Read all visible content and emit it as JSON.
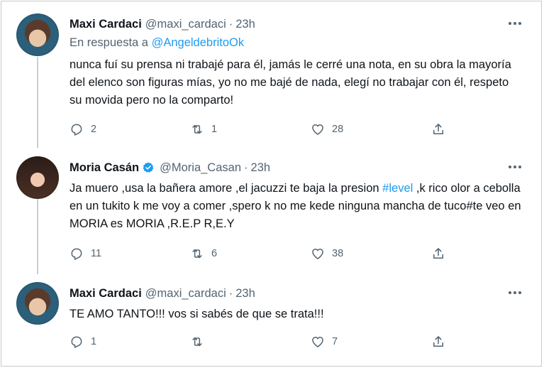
{
  "tweets": [
    {
      "name": "Maxi Cardaci",
      "handle": "@maxi_cardaci",
      "dot": "·",
      "time": "23h",
      "reply_prefix": "En respuesta a",
      "reply_handle": "@AngeldebritoOk",
      "text": "nunca fuí su prensa ni trabajé para él, jamás le cerré una nota, en su obra la mayoría del elenco son figuras mías, yo no me bajé de nada, elegí no trabajar con él, respeto su movida pero no la comparto!",
      "replies": "2",
      "retweets": "1",
      "likes": "28",
      "verified": false
    },
    {
      "name": "Moria Casán",
      "handle": "@Moria_Casan",
      "dot": "·",
      "time": "23h",
      "text_before": "Ja muero ,usa la bañera amore ,el jacuzzi te baja la presion ",
      "hashtag": "#level",
      "text_after": " ,k rico olor a cebolla en un tukito k me voy a comer ,spero k no me kede ninguna mancha de tuco#te veo en MORIA es MORIA ,R.E.P R,E.Y",
      "replies": "11",
      "retweets": "6",
      "likes": "38",
      "verified": true
    },
    {
      "name": "Maxi Cardaci",
      "handle": "@maxi_cardaci",
      "dot": "·",
      "time": "23h",
      "text": "TE AMO TANTO!!! vos si sabés de que se trata!!!",
      "replies": "1",
      "retweets": "",
      "likes": "7",
      "verified": false
    }
  ],
  "icons": {
    "more": "more-icon",
    "reply": "reply-icon",
    "retweet": "retweet-icon",
    "like": "heart-icon",
    "share": "share-icon",
    "verified": "verified-badge-icon"
  },
  "colors": {
    "text": "#0f1419",
    "muted": "#536471",
    "link": "#1d9bf0",
    "thread_line": "#c4cfd6"
  }
}
